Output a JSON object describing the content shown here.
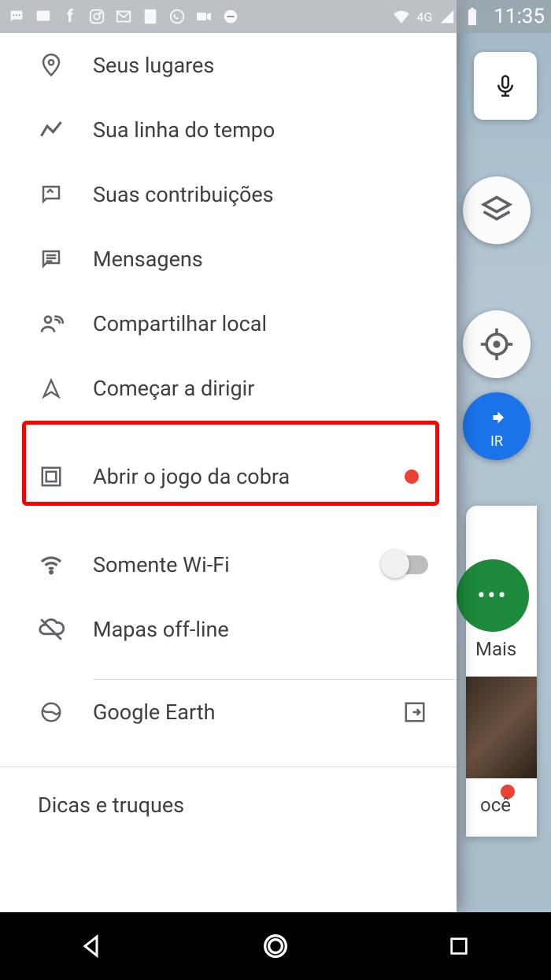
{
  "statusbar": {
    "time": "11:35",
    "signal": "4G"
  },
  "background": {
    "go_label": "IR",
    "more_label": "Mais",
    "foryou_fragment": "ocê"
  },
  "drawer": {
    "items": [
      {
        "icon": "pin",
        "label": "Seus lugares"
      },
      {
        "icon": "timeline",
        "label": "Sua linha do tempo"
      },
      {
        "icon": "contrib",
        "label": "Suas contribuições"
      },
      {
        "icon": "messages",
        "label": "Mensagens"
      },
      {
        "icon": "share-location",
        "label": "Compartilhar local"
      },
      {
        "icon": "drive",
        "label": "Começar a dirigir"
      },
      {
        "icon": "snake",
        "label": "Abrir o jogo da cobra"
      },
      {
        "icon": "wifi",
        "label": "Somente Wi-Fi"
      },
      {
        "icon": "cloud-off",
        "label": "Mapas off-line"
      },
      {
        "icon": "earth",
        "label": "Google Earth"
      }
    ],
    "section_tips": "Dicas e truques"
  }
}
